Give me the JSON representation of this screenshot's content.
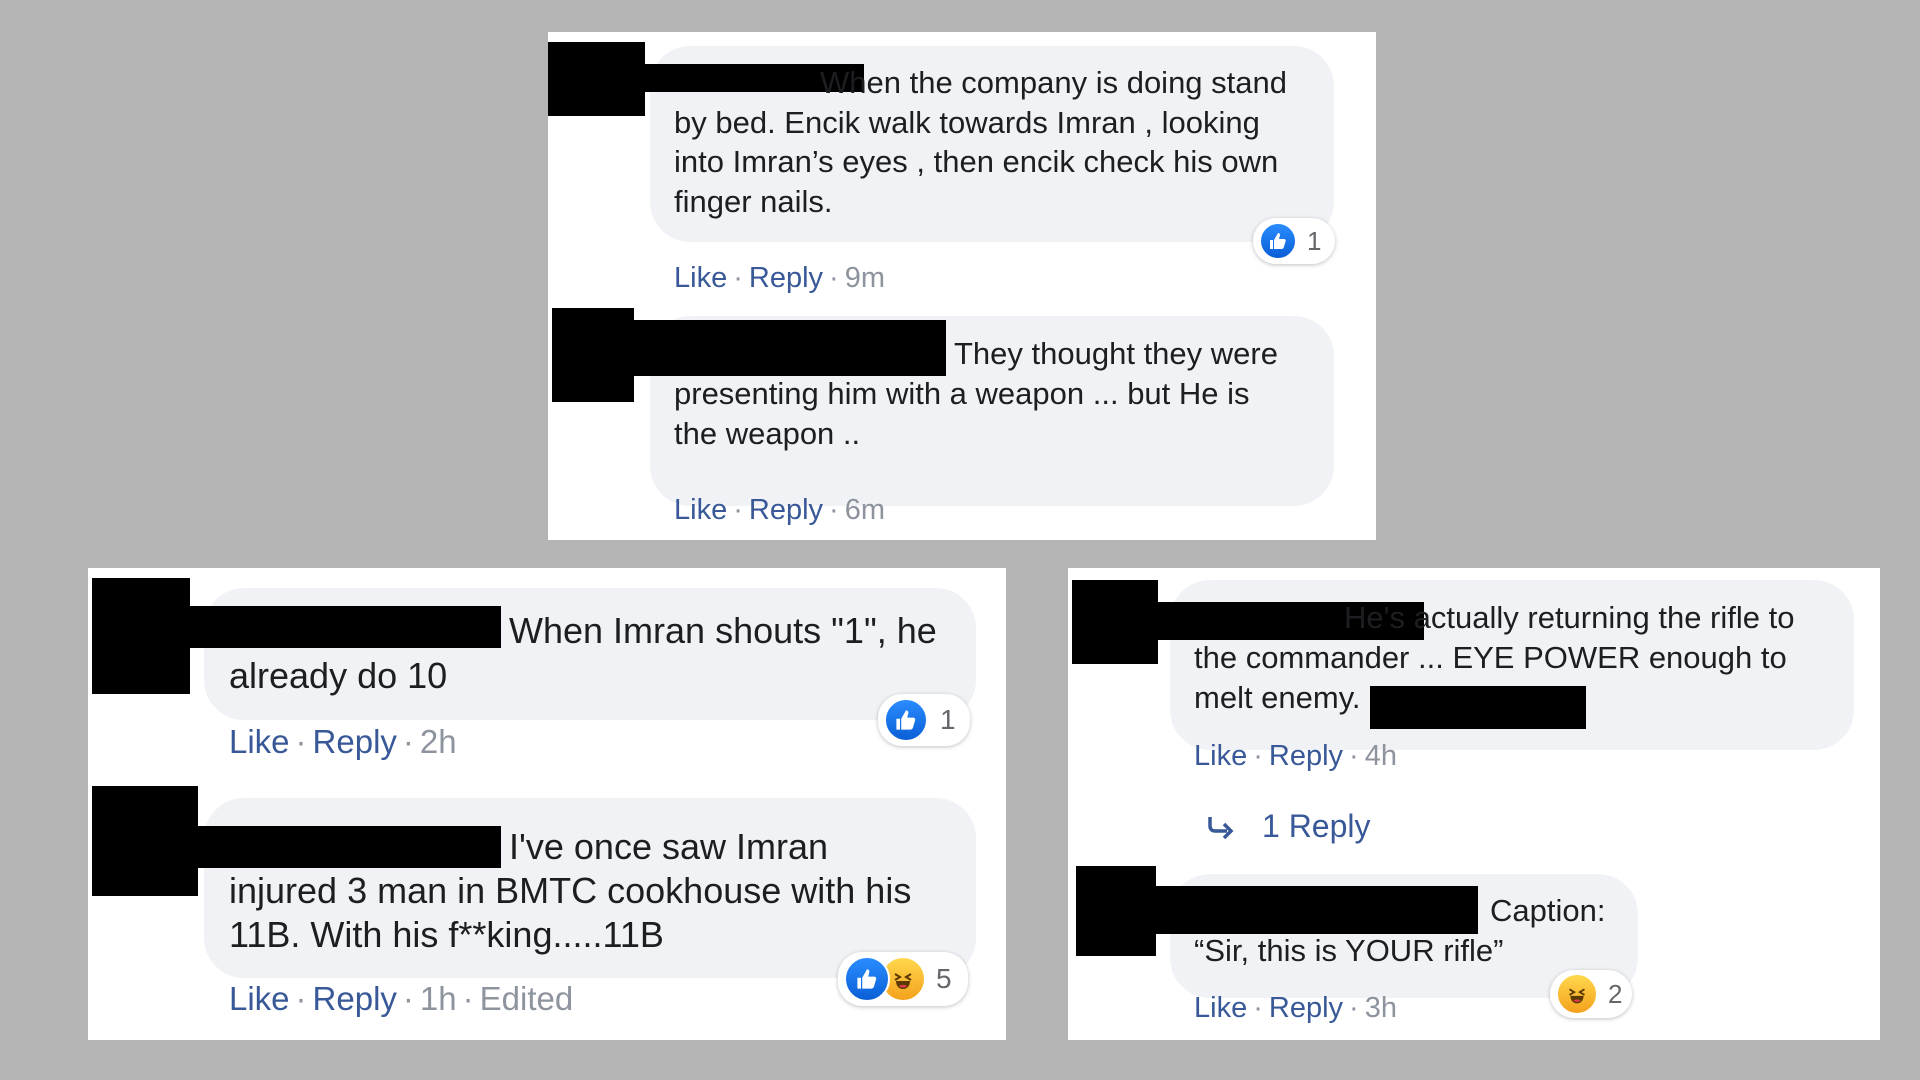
{
  "colors": {
    "background": "#b5b4b4",
    "panel": "#ffffff",
    "bubble": "#f0f2f5",
    "link": "#385898",
    "meta": "#8d949e",
    "like_blue": "#1877f2"
  },
  "comments": [
    {
      "lines": [
        "When the company is doing stand",
        "by bed. Encik walk towards Imran , looking",
        "into Imran’s eyes , then encik check his own",
        "finger nails."
      ],
      "like_label": "Like",
      "reply_label": "Reply",
      "time": "9m",
      "reaction_count": "1",
      "reaction_icons": [
        "like-icon"
      ]
    },
    {
      "lines": [
        "They thought they were",
        "presenting him with a weapon ... but He is",
        "the weapon .."
      ],
      "like_label": "Like",
      "reply_label": "Reply",
      "time": "6m"
    },
    {
      "lines": [
        "When Imran shouts \"1\", he",
        "already do 10"
      ],
      "like_label": "Like",
      "reply_label": "Reply",
      "time": "2h",
      "reaction_count": "1",
      "reaction_icons": [
        "like-icon"
      ]
    },
    {
      "lines": [
        "I've once saw Imran",
        "injured 3 man in BMTC cookhouse with his",
        "11B. With his f**king.....11B"
      ],
      "like_label": "Like",
      "reply_label": "Reply",
      "time": "1h",
      "edited": "Edited",
      "reaction_count": "5",
      "reaction_icons": [
        "like-icon",
        "haha-icon"
      ]
    },
    {
      "lines": [
        "He's actually returning the rifle to",
        "the commander ... EYE POWER enough to",
        "melt enemy."
      ],
      "like_label": "Like",
      "reply_label": "Reply",
      "time": "4h",
      "replies_label": "1 Reply"
    },
    {
      "lines": [
        "Caption:",
        "“Sir, this is YOUR rifle”"
      ],
      "like_label": "Like",
      "reply_label": "Reply",
      "time": "3h",
      "reaction_count": "2",
      "reaction_icons": [
        "haha-icon"
      ]
    }
  ]
}
